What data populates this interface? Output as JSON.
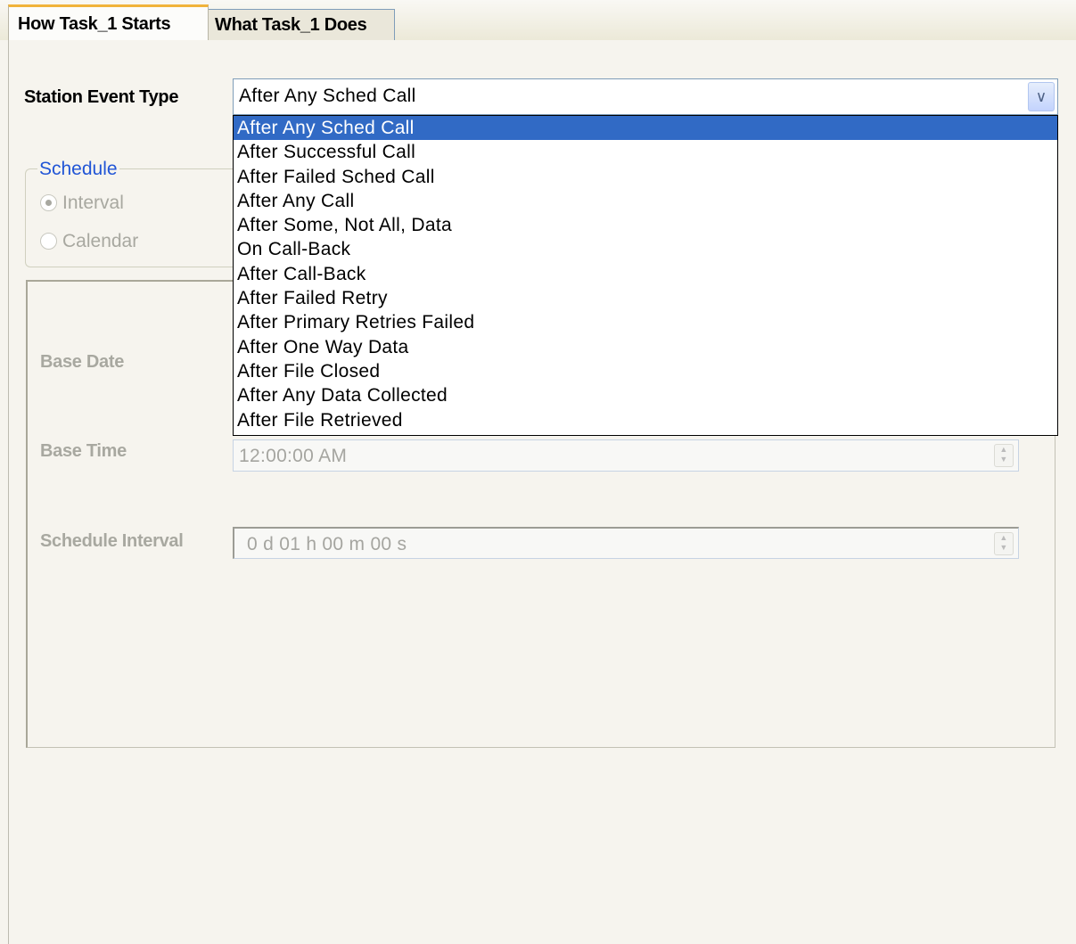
{
  "tabs": [
    {
      "label": "How Task_1 Starts",
      "active": true
    },
    {
      "label": "What Task_1 Does",
      "active": false
    }
  ],
  "station_event": {
    "label": "Station Event Type",
    "value": "After Any Sched Call",
    "options": [
      "After Any Sched Call",
      "After Successful Call",
      "After Failed Sched Call",
      "After Any Call",
      "After Some, Not All, Data",
      "On Call-Back",
      "After Call-Back",
      "After Failed Retry",
      "After Primary Retries Failed",
      "After One Way Data",
      "After File Closed",
      "After Any Data Collected",
      "After File Retrieved"
    ],
    "highlighted_index": 0
  },
  "schedule": {
    "legend": "Schedule",
    "options": [
      {
        "label": "Interval",
        "checked": true
      },
      {
        "label": "Calendar",
        "checked": false
      }
    ]
  },
  "base_date": {
    "label": "Base Date"
  },
  "base_time": {
    "label": "Base Time",
    "value": "12:00:00 AM"
  },
  "schedule_interval": {
    "label": "Schedule Interval",
    "value": "0 d 01 h 00 m 00 s"
  },
  "colors": {
    "selection": "#316ac5",
    "active_tab_accent": "#f0b33a",
    "legend_text": "#2155d6",
    "disabled_text": "#a8a8a0"
  }
}
